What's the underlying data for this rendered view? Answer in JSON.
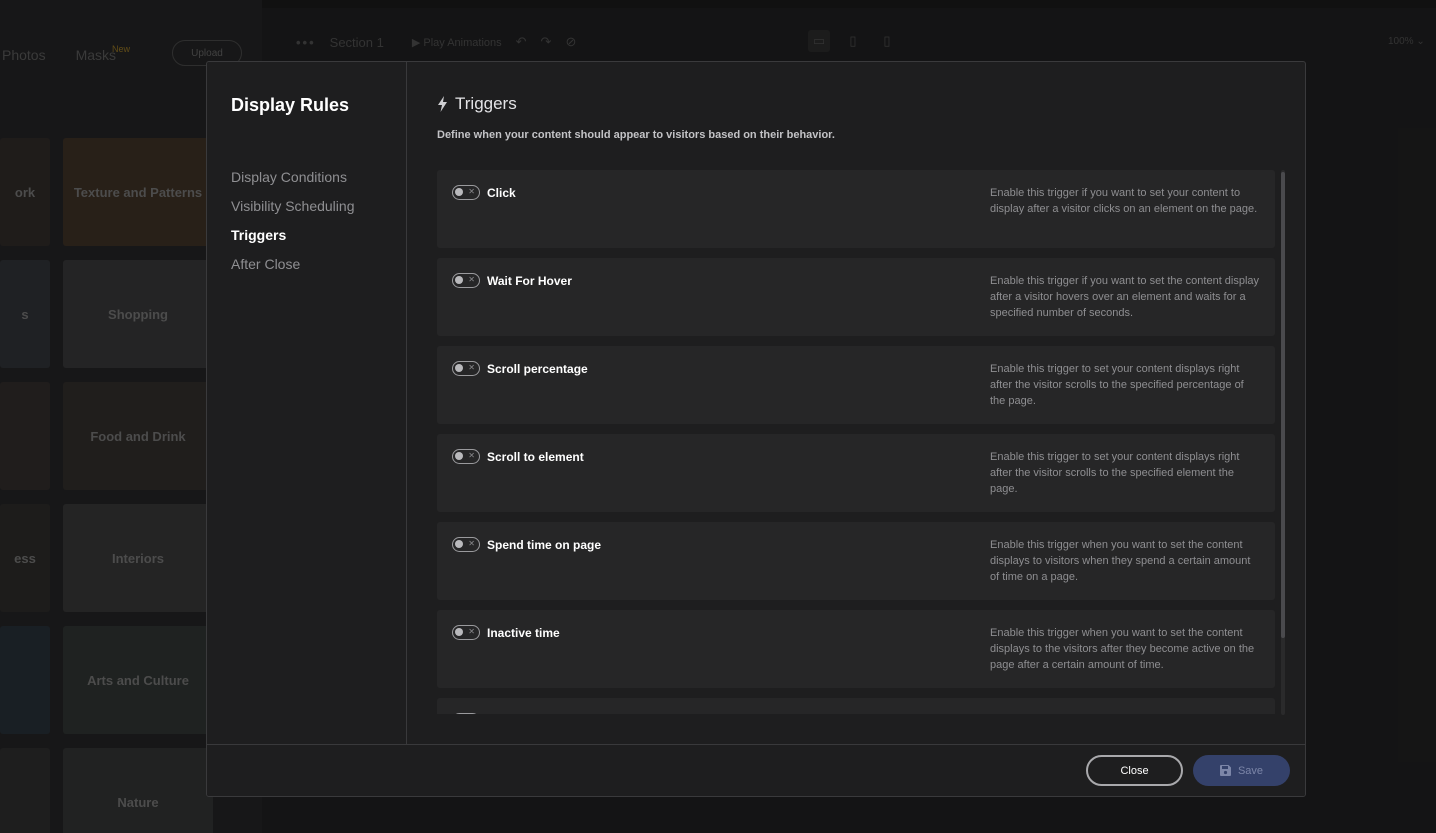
{
  "background": {
    "panel_tabs": [
      "Photos",
      "Masks"
    ],
    "tab_badge": "New",
    "upload_label": "Upload",
    "section_label": "Section 1",
    "play_label": "Play Animations",
    "zoom_label": "100%",
    "tiles": [
      "Texture and Patterns",
      "Shopping",
      "Food and Drink",
      "Interiors",
      "Arts and Culture",
      "Nature"
    ],
    "left_tiles": [
      "ork",
      "s",
      "",
      "ess",
      "",
      ""
    ]
  },
  "modal": {
    "title": "Display Rules",
    "nav": [
      {
        "label": "Display Conditions",
        "active": false
      },
      {
        "label": "Visibility Scheduling",
        "active": false
      },
      {
        "label": "Triggers",
        "active": true
      },
      {
        "label": "After Close",
        "active": false
      }
    ],
    "section_title": "Triggers",
    "section_icon": "bolt-icon",
    "description": "Define when your content should appear to visitors based on their behavior.",
    "triggers": [
      {
        "label": "Click",
        "enabled": false,
        "help": "Enable this trigger if you want to set your content to display after a visitor clicks on an element on the page."
      },
      {
        "label": "Wait For Hover",
        "enabled": false,
        "help": "Enable this trigger if you want to set the content display after a visitor hovers over an element and waits for a specified number of seconds."
      },
      {
        "label": "Scroll percentage",
        "enabled": false,
        "help": "Enable this trigger to set your content displays right after the visitor scrolls to the specified percentage of the page."
      },
      {
        "label": "Scroll to element",
        "enabled": false,
        "help": "Enable this trigger to set your content displays right after the visitor scrolls to the specified element the page."
      },
      {
        "label": "Spend time on page",
        "enabled": false,
        "help": "Enable this trigger when you want to set the content displays to visitors when they spend a certain amount of time on a page."
      },
      {
        "label": "Inactive time",
        "enabled": false,
        "help": "Enable this trigger when you want to set the content displays to the visitors after they become active on the page after a certain amount of time."
      }
    ],
    "footer": {
      "close_label": "Close",
      "save_label": "Save",
      "save_icon": "floppy-disk-icon"
    }
  },
  "colors": {
    "modal_bg": "#1e1e1f",
    "card_bg": "#262627",
    "save_button_bg": "#34416a"
  }
}
